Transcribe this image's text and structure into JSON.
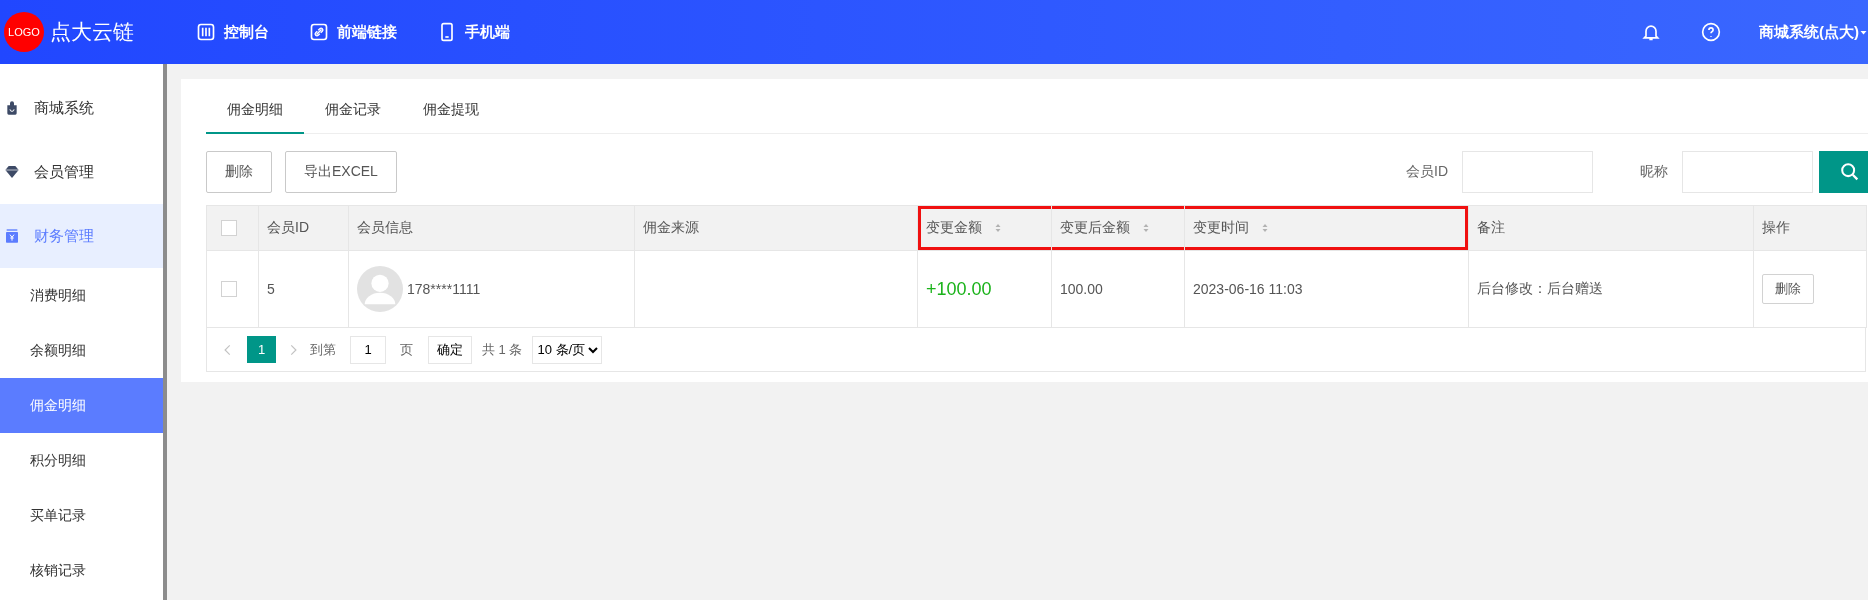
{
  "header": {
    "logo": "LOGO",
    "title": "点大云链",
    "nav": [
      {
        "label": "控制台",
        "kind": "console"
      },
      {
        "label": "前端链接",
        "kind": "link"
      },
      {
        "label": "手机端",
        "kind": "phone"
      }
    ],
    "user": "商城系统(点大)"
  },
  "sidebar": {
    "items": [
      {
        "label": "商城系统",
        "kind": "bag",
        "active": false
      },
      {
        "label": "会员管理",
        "kind": "gem",
        "active": false
      },
      {
        "label": "财务管理",
        "kind": "money",
        "active": true,
        "children": [
          {
            "label": "消费明细",
            "selected": false
          },
          {
            "label": "余额明细",
            "selected": false
          },
          {
            "label": "佣金明细",
            "selected": true
          },
          {
            "label": "积分明细",
            "selected": false
          },
          {
            "label": "买单记录",
            "selected": false
          },
          {
            "label": "核销记录",
            "selected": false
          }
        ]
      }
    ]
  },
  "tabs": [
    {
      "label": "佣金明细",
      "selected": true
    },
    {
      "label": "佣金记录",
      "selected": false
    },
    {
      "label": "佣金提现",
      "selected": false
    }
  ],
  "toolbar": {
    "buttons": [
      "删除",
      "导出EXCEL"
    ],
    "filters": [
      {
        "label": "会员ID"
      },
      {
        "label": "昵称"
      }
    ]
  },
  "table": {
    "columns": [
      {
        "kind": "check",
        "highlighted": false
      },
      {
        "label": "会员ID",
        "kind": "text",
        "sortable": false,
        "highlighted": false
      },
      {
        "label": "会员信息",
        "kind": "text",
        "sortable": false,
        "highlighted": false
      },
      {
        "label": "佣金来源",
        "kind": "text",
        "sortable": false,
        "highlighted": false
      },
      {
        "label": "变更金额",
        "kind": "text",
        "sortable": true,
        "highlighted": true
      },
      {
        "label": "变更后金额",
        "kind": "text",
        "sortable": true,
        "highlighted": true
      },
      {
        "label": "变更时间",
        "kind": "text",
        "sortable": true,
        "highlighted": true
      },
      {
        "label": "备注",
        "kind": "text",
        "sortable": false,
        "highlighted": false
      },
      {
        "label": "操作",
        "kind": "text",
        "sortable": false,
        "highlighted": false
      }
    ],
    "rows": [
      {
        "checked": false,
        "member_id": "5",
        "phone": "178****1111",
        "change": "+100.00",
        "balance_after": "100.00",
        "time": "2023-06-16 11:03",
        "remark": "后台修改：后台赠送",
        "action": "删除"
      }
    ]
  },
  "pagination": {
    "pages": [
      {
        "label": "1",
        "selected": true
      }
    ],
    "goto_label": "到第",
    "page_value": "1",
    "page_unit": "页",
    "confirm": "确定",
    "total": "共 1 条",
    "page_size": "10 条/页"
  }
}
